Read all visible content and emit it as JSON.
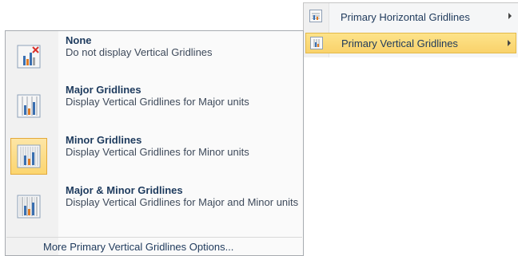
{
  "parent_menu": {
    "items": [
      {
        "label": "Primary Horizontal Gridlines",
        "icon": "horizontal-gridlines-icon",
        "has_submenu": true
      },
      {
        "label": "Primary Vertical Gridlines",
        "icon": "vertical-gridlines-icon",
        "has_submenu": true,
        "highlighted": true
      }
    ]
  },
  "submenu": {
    "items": [
      {
        "title": "None",
        "description": "Do not display Vertical Gridlines",
        "icon": "no-gridlines-icon"
      },
      {
        "title": "Major Gridlines",
        "description": "Display Vertical Gridlines for Major units",
        "icon": "major-gridlines-icon"
      },
      {
        "title": "Minor Gridlines",
        "description": "Display Vertical Gridlines for Minor units",
        "icon": "minor-gridlines-icon",
        "selected": true
      },
      {
        "title": "Major & Minor Gridlines",
        "description": "Display Vertical Gridlines for Major and Minor units",
        "icon": "major-minor-gridlines-icon"
      }
    ],
    "footer": "More Primary Vertical Gridlines Options..."
  },
  "colors": {
    "highlight": "#fcd56f",
    "highlight_border": "#e3a93b",
    "text_title": "#1d3a5d",
    "text_desc": "#3e4a5b"
  }
}
